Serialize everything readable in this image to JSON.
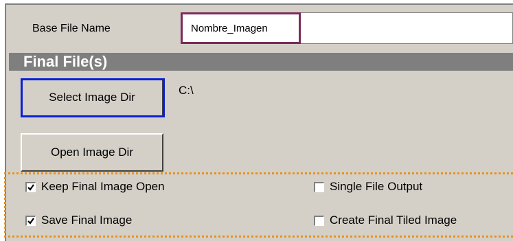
{
  "base_file": {
    "label": "Base File Name",
    "value": "Nombre_Imagen"
  },
  "final_files": {
    "section_title": "Final File(s)",
    "select_dir_button": "Select Image Dir",
    "open_dir_button": "Open Image Dir",
    "image_dir_path": "C:\\"
  },
  "options": {
    "keep_open": {
      "label": "Keep Final Image Open",
      "checked": true
    },
    "save_final": {
      "label": "Save Final Image",
      "checked": true
    },
    "single_file": {
      "label": "Single File Output",
      "checked": false
    },
    "create_tiled": {
      "label": "Create Final Tiled Image",
      "checked": false
    }
  },
  "colors": {
    "panel": "#d4d0c8",
    "section_bar": "#7f7f7f",
    "highlight_purple": "#7b2a5c",
    "highlight_blue": "#0a1fd6",
    "highlight_orange": "#e8901c"
  }
}
